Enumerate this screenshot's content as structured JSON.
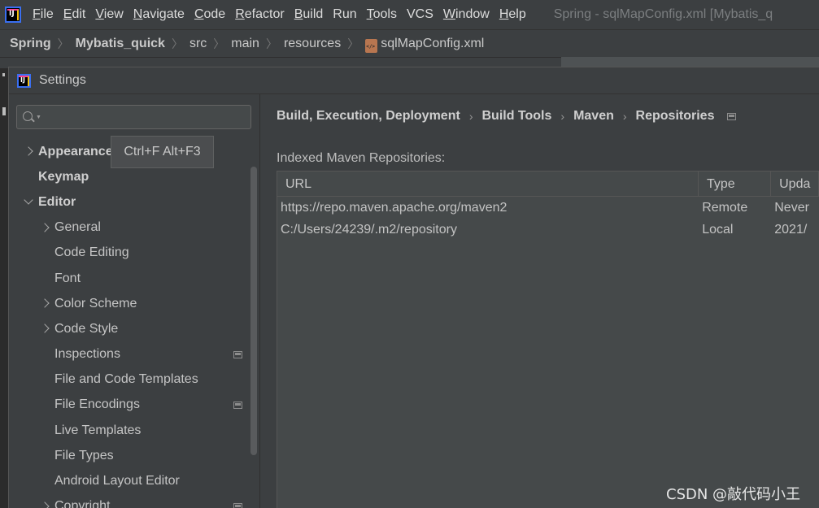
{
  "menubar": {
    "items": [
      {
        "label": "File",
        "u": "F",
        "rest": "ile"
      },
      {
        "label": "Edit",
        "u": "E",
        "rest": "dit"
      },
      {
        "label": "View",
        "u": "V",
        "rest": "iew"
      },
      {
        "label": "Navigate",
        "u": "N",
        "rest": "avigate"
      },
      {
        "label": "Code",
        "u": "C",
        "rest": "ode"
      },
      {
        "label": "Refactor",
        "u": "R",
        "rest": "efactor"
      },
      {
        "label": "Build",
        "u": "B",
        "rest": "uild"
      },
      {
        "label": "Run",
        "u": "",
        "rest": "Run"
      },
      {
        "label": "Tools",
        "u": "T",
        "rest": "ools"
      },
      {
        "label": "VCS",
        "u": "",
        "rest": "VCS"
      },
      {
        "label": "Window",
        "u": "W",
        "rest": "indow"
      },
      {
        "label": "Help",
        "u": "H",
        "rest": "elp"
      }
    ],
    "window_title": "Spring - sqlMapConfig.xml [Mybatis_q"
  },
  "breadcrumb": {
    "items": [
      "Spring",
      "Mybatis_quick",
      "src",
      "main",
      "resources"
    ],
    "file": "sqlMapConfig.xml"
  },
  "dialog": {
    "title": "Settings",
    "search": {
      "value": "",
      "placeholder": ""
    },
    "tooltip": "Ctrl+F Alt+F3",
    "tree": [
      {
        "label": "Appearance",
        "level": 0,
        "expand": "right",
        "bold": true,
        "project": false
      },
      {
        "label": "Keymap",
        "level": 0,
        "expand": "none",
        "bold": true,
        "project": false
      },
      {
        "label": "Editor",
        "level": 0,
        "expand": "down",
        "bold": true,
        "project": false
      },
      {
        "label": "General",
        "level": 1,
        "expand": "right",
        "bold": false,
        "project": false
      },
      {
        "label": "Code Editing",
        "level": 1,
        "expand": "none",
        "bold": false,
        "project": false
      },
      {
        "label": "Font",
        "level": 1,
        "expand": "none",
        "bold": false,
        "project": false
      },
      {
        "label": "Color Scheme",
        "level": 1,
        "expand": "right",
        "bold": false,
        "project": false
      },
      {
        "label": "Code Style",
        "level": 1,
        "expand": "right",
        "bold": false,
        "project": false
      },
      {
        "label": "Inspections",
        "level": 1,
        "expand": "none",
        "bold": false,
        "project": true
      },
      {
        "label": "File and Code Templates",
        "level": 1,
        "expand": "none",
        "bold": false,
        "project": false
      },
      {
        "label": "File Encodings",
        "level": 1,
        "expand": "none",
        "bold": false,
        "project": true
      },
      {
        "label": "Live Templates",
        "level": 1,
        "expand": "none",
        "bold": false,
        "project": false
      },
      {
        "label": "File Types",
        "level": 1,
        "expand": "none",
        "bold": false,
        "project": false
      },
      {
        "label": "Android Layout Editor",
        "level": 1,
        "expand": "none",
        "bold": false,
        "project": false
      },
      {
        "label": "Copyright",
        "level": 1,
        "expand": "right",
        "bold": false,
        "project": true
      }
    ],
    "page_path": [
      "Build, Execution, Deployment",
      "Build Tools",
      "Maven",
      "Repositories"
    ],
    "section_label": "Indexed Maven Repositories:",
    "table": {
      "headers": [
        "URL",
        "Type",
        "Upda"
      ],
      "rows": [
        [
          "https://repo.maven.apache.org/maven2",
          "Remote",
          "Never"
        ],
        [
          "C:/Users/24239/.m2/repository",
          "Local",
          "2021/"
        ]
      ]
    }
  },
  "watermark": "CSDN @敲代码小王"
}
